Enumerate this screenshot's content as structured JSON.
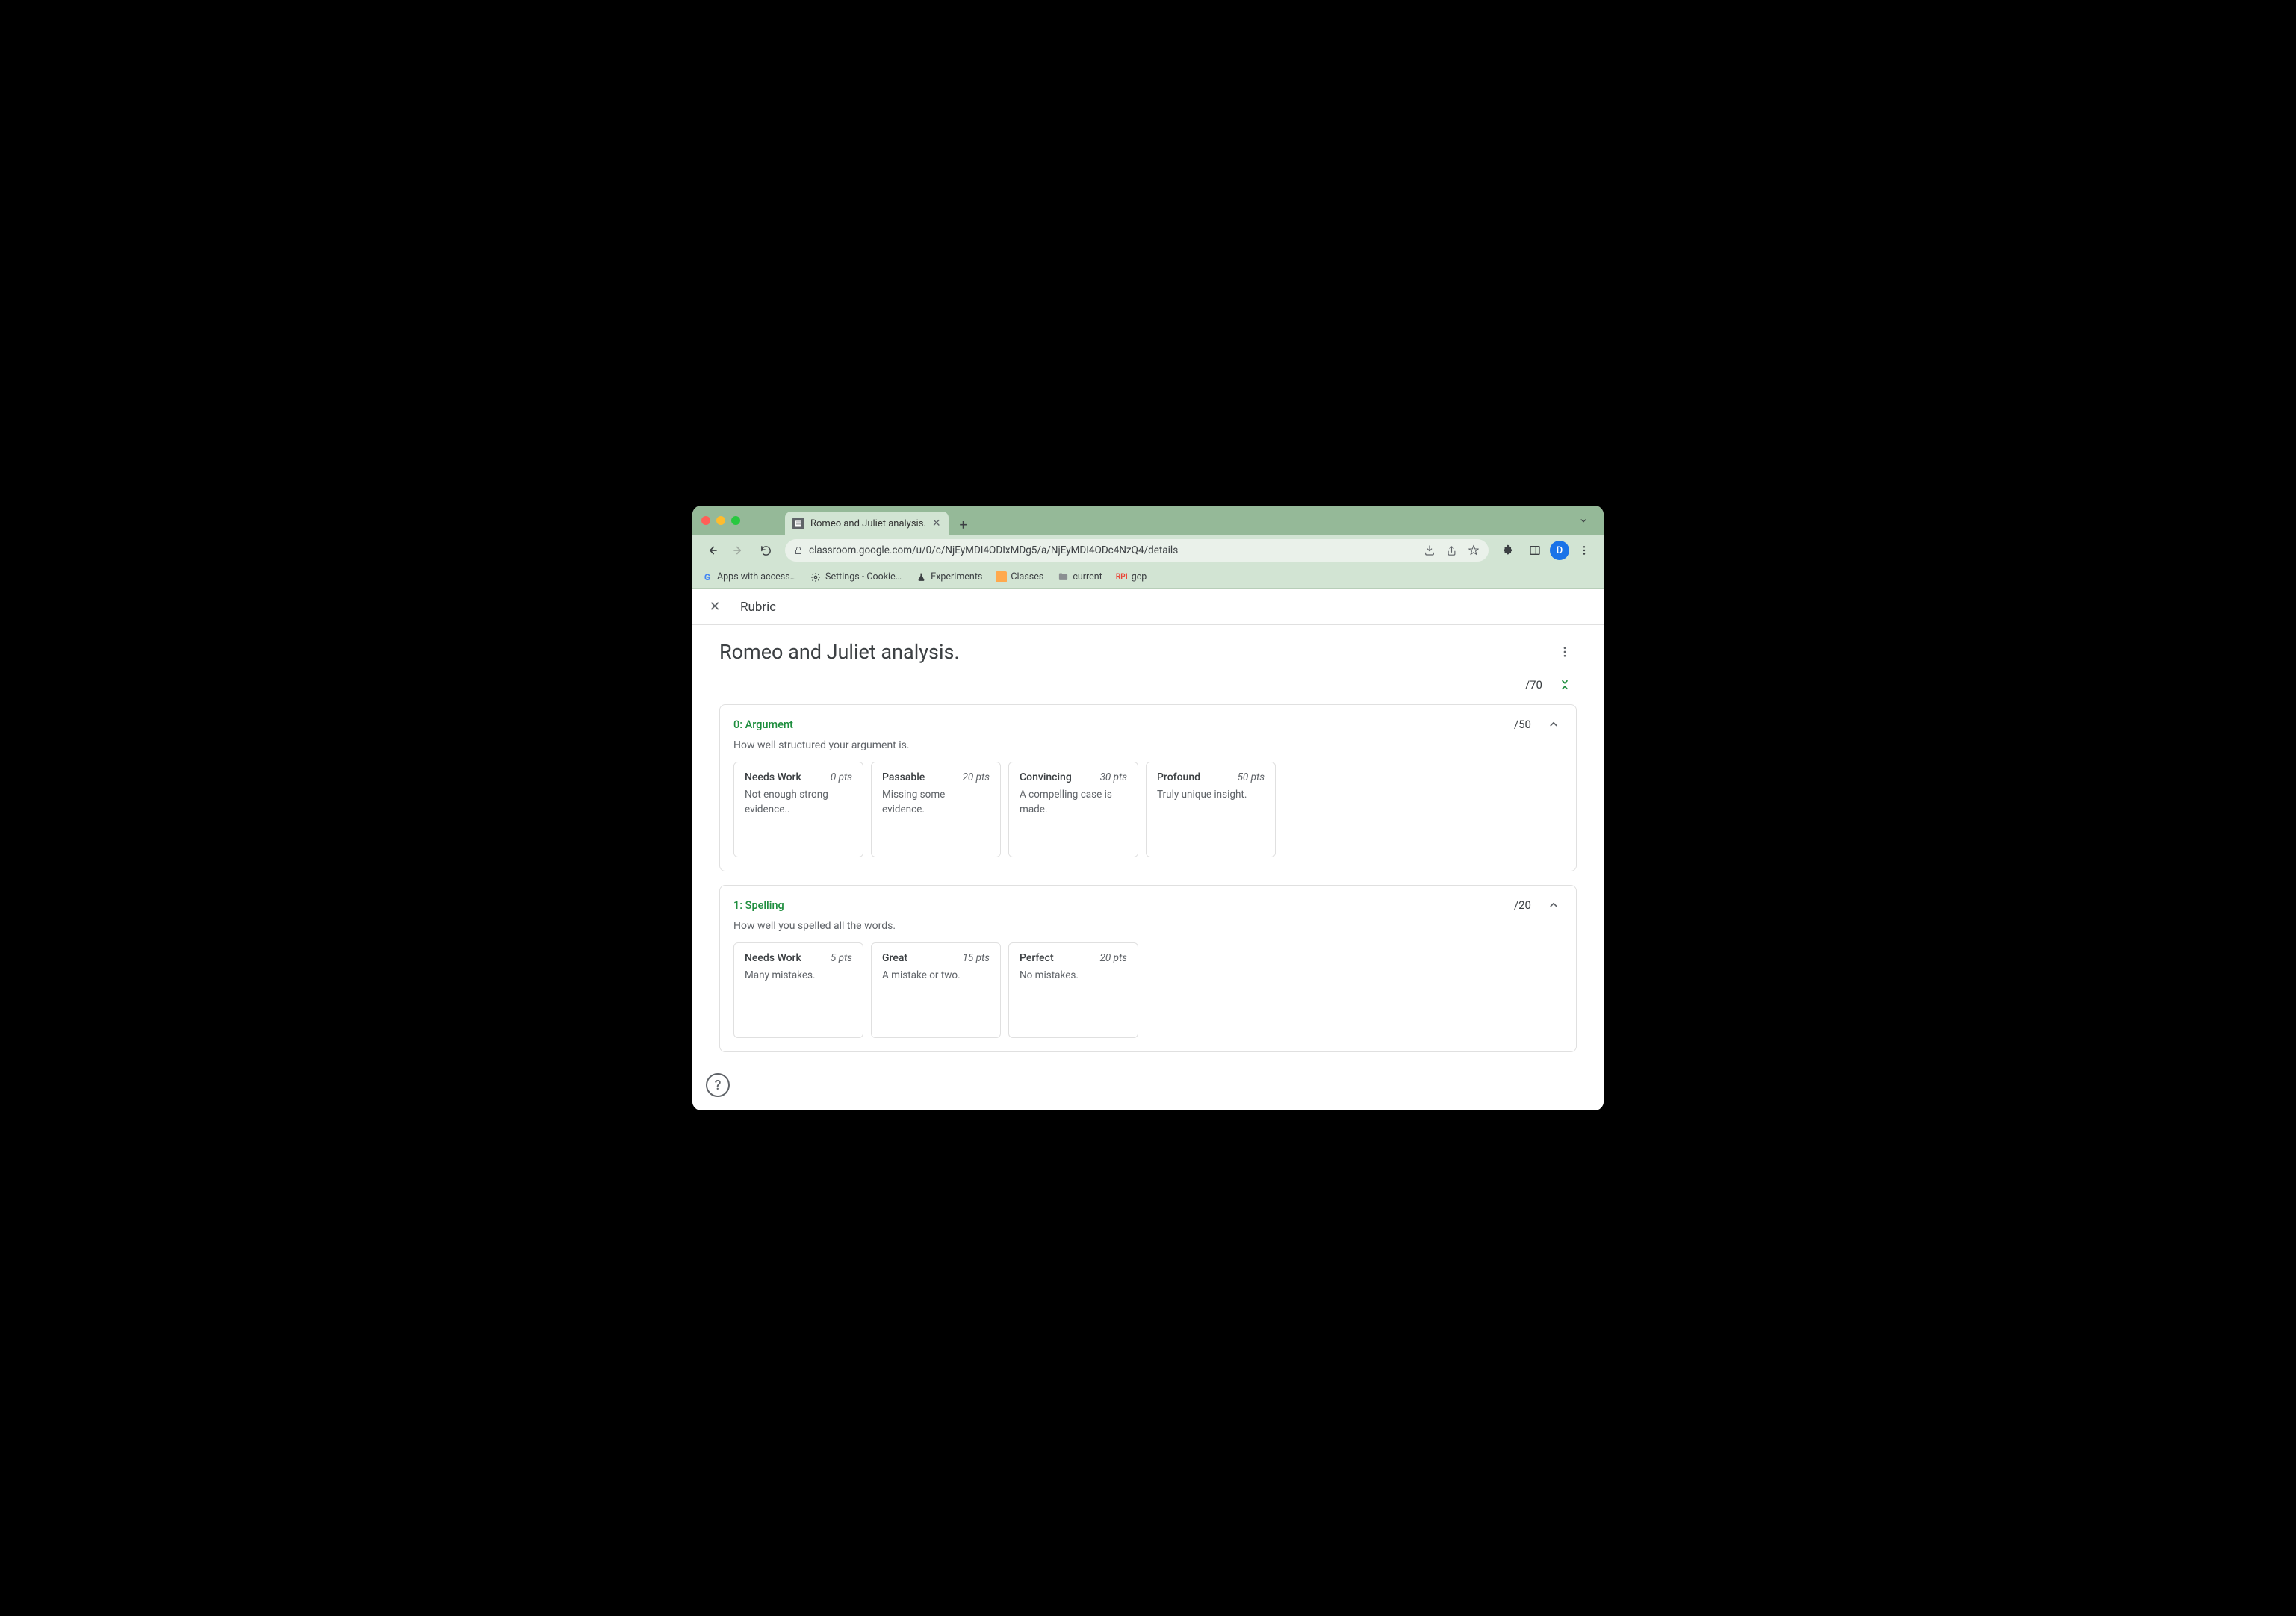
{
  "browser": {
    "tab_title": "Romeo and Juliet analysis.",
    "url": "classroom.google.com/u/0/c/NjEyMDI4ODIxMDg5/a/NjEyMDI4ODc4NzQ4/details",
    "avatar_letter": "D"
  },
  "bookmarks": {
    "apps": "Apps with access…",
    "settings": "Settings - Cookie…",
    "experiments": "Experiments",
    "classes": "Classes",
    "current": "current",
    "rpi": "RPI",
    "gcp": "gcp"
  },
  "header": {
    "rubric_label": "Rubric"
  },
  "page": {
    "title": "Romeo and Juliet analysis.",
    "total_points": "/70"
  },
  "criteria": [
    {
      "title": "0: Argument",
      "points": "/50",
      "description": "How well structured your argument is.",
      "levels": [
        {
          "title": "Needs Work",
          "pts": "0 pts",
          "desc": "Not enough strong evidence.."
        },
        {
          "title": "Passable",
          "pts": "20 pts",
          "desc": "Missing some evidence."
        },
        {
          "title": "Convincing",
          "pts": "30 pts",
          "desc": "A compelling case is made."
        },
        {
          "title": "Profound",
          "pts": "50 pts",
          "desc": "Truly unique insight."
        }
      ]
    },
    {
      "title": "1: Spelling",
      "points": "/20",
      "description": "How well you spelled all the words.",
      "levels": [
        {
          "title": "Needs Work",
          "pts": "5 pts",
          "desc": "Many mistakes."
        },
        {
          "title": "Great",
          "pts": "15 pts",
          "desc": "A mistake or two."
        },
        {
          "title": "Perfect",
          "pts": "20 pts",
          "desc": "No mistakes."
        }
      ]
    }
  ],
  "help": "?"
}
